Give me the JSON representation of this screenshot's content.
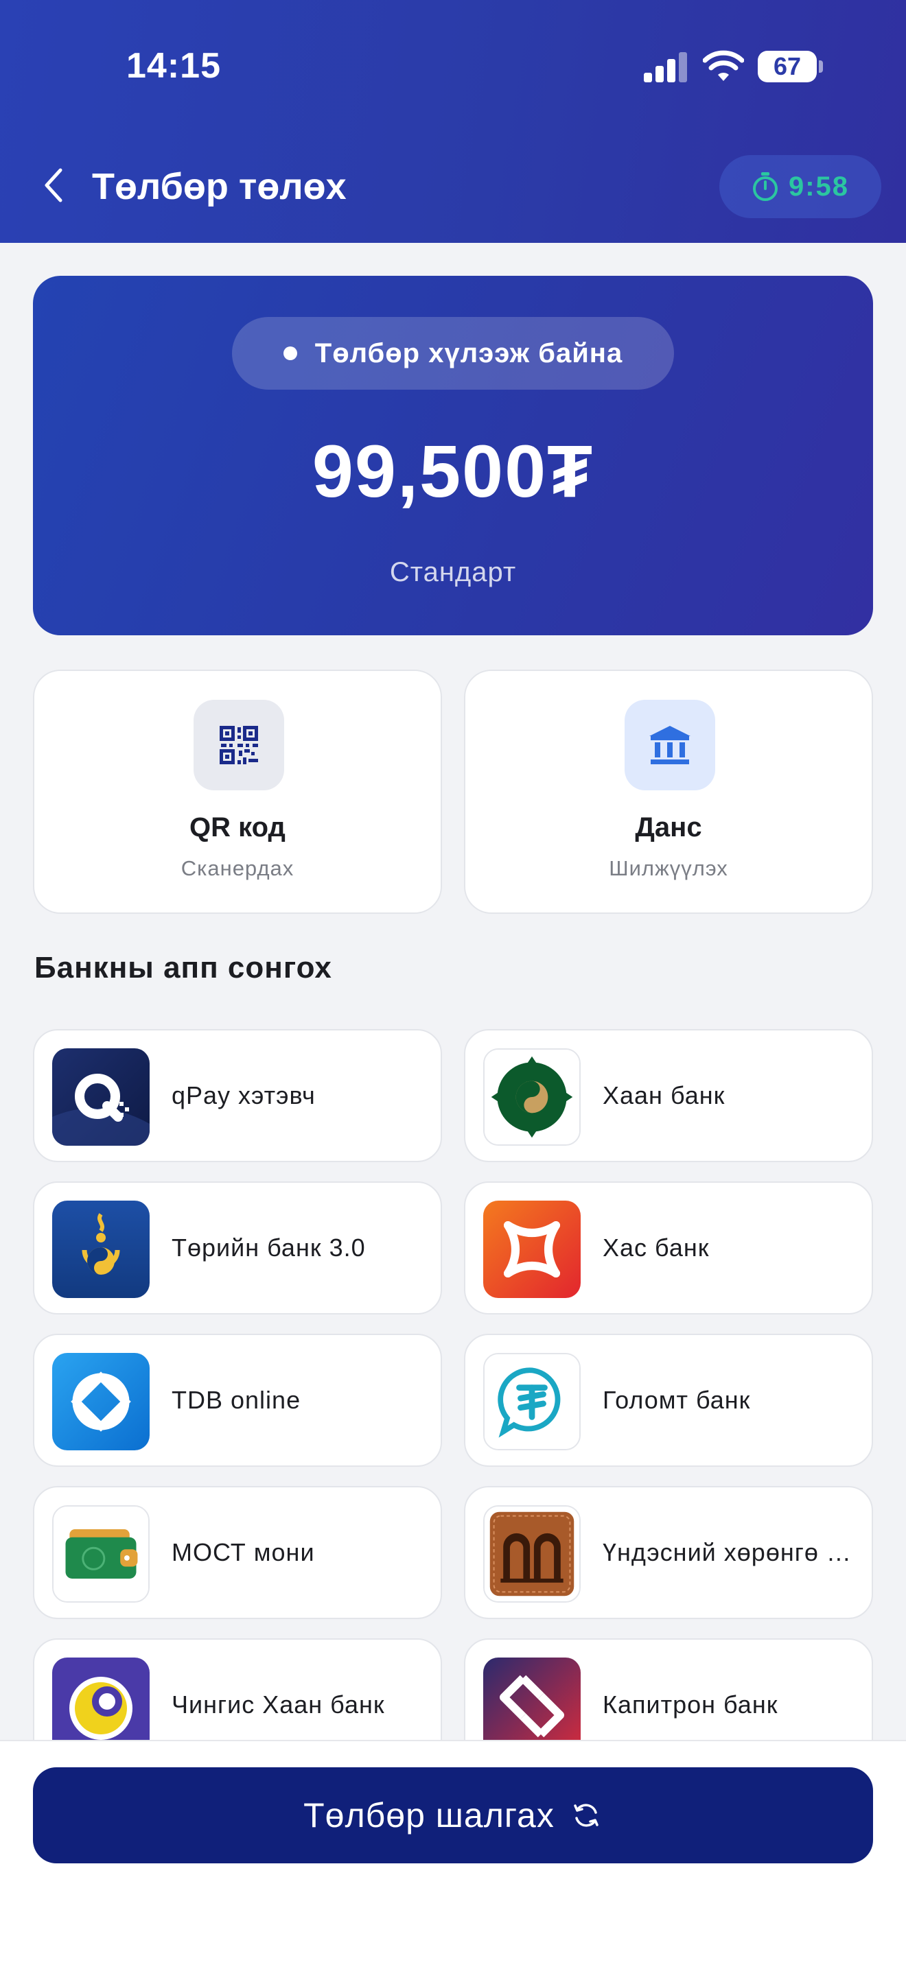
{
  "status_bar": {
    "time": "14:15",
    "battery": "67"
  },
  "header": {
    "title": "Төлбөр төлөх",
    "timer": "9:58"
  },
  "payment": {
    "status": "Төлбөр хүлээж байна",
    "amount": "99,500₮",
    "plan": "Стандарт"
  },
  "methods": [
    {
      "title": "QR код",
      "subtitle": "Сканердах",
      "icon": "qr-code-icon"
    },
    {
      "title": "Данс",
      "subtitle": "Шилжүүлэх",
      "icon": "bank-building-icon"
    }
  ],
  "banks_section_title": "Банкны апп сонгох",
  "banks": [
    {
      "name": "qPay хэтэвч"
    },
    {
      "name": "Хаан банк"
    },
    {
      "name": "Төрийн банк 3.0"
    },
    {
      "name": "Хас банк"
    },
    {
      "name": "TDB online"
    },
    {
      "name": "Голомт банк"
    },
    {
      "name": "МОСТ мони"
    },
    {
      "name": "Үндэсний хөрөнгө оруулалтын банк"
    },
    {
      "name": "Чингис Хаан банк"
    },
    {
      "name": "Капитрон банк"
    }
  ],
  "actions": {
    "check_payment": "Төлбөр шалгах"
  },
  "colors": {
    "header": "#2a41b4",
    "primary_button": "#10207a",
    "timer": "#2bc6a0"
  }
}
